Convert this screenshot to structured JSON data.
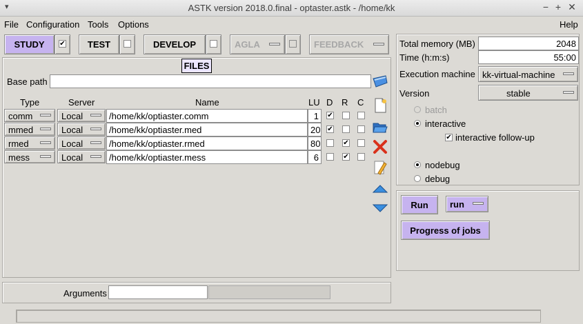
{
  "window": {
    "title": "ASTK version 2018.0.final - optaster.astk - /home/kk",
    "menu_arrow": "▾",
    "minimize": "−",
    "maximize": "+",
    "close": "✕"
  },
  "menubar": {
    "file": "File",
    "configuration": "Configuration",
    "tools": "Tools",
    "options": "Options",
    "help": "Help"
  },
  "modes": {
    "study": "STUDY",
    "test": "TEST",
    "develop": "DEVELOP",
    "agla": "AGLA",
    "feedback": "FEEDBACK"
  },
  "files_panel": {
    "title": "FILES",
    "base_path_label": "Base path",
    "base_path_value": "",
    "col_type": "Type",
    "col_server": "Server",
    "col_name": "Name",
    "col_lu": "LU",
    "col_d": "D",
    "col_r": "R",
    "col_c": "C",
    "rows": [
      {
        "type": "comm",
        "server": "Local",
        "name": "/home/kk/optiaster.comm",
        "lu": "1",
        "d": true,
        "r": false,
        "c": false
      },
      {
        "type": "mmed",
        "server": "Local",
        "name": "/home/kk/optiaster.med",
        "lu": "20",
        "d": true,
        "r": false,
        "c": false
      },
      {
        "type": "rmed",
        "server": "Local",
        "name": "/home/kk/optiaster.rmed",
        "lu": "80",
        "d": false,
        "r": true,
        "c": false
      },
      {
        "type": "mess",
        "server": "Local",
        "name": "/home/kk/optiaster.mess",
        "lu": "6",
        "d": false,
        "r": true,
        "c": false
      }
    ],
    "arguments_label": "Arguments",
    "arguments_value": ""
  },
  "params": {
    "total_memory_label": "Total memory (MB)",
    "total_memory_value": "2048",
    "time_label": "Time (h:m:s)",
    "time_value": "55:00",
    "exec_machine_label": "Execution machine",
    "exec_machine_value": "kk-virtual-machine",
    "version_label": "Version",
    "version_value": "stable",
    "batch": "batch",
    "interactive": "interactive",
    "interactive_followup": "interactive follow-up",
    "nodebug": "nodebug",
    "debug": "debug"
  },
  "run": {
    "run_button": "Run",
    "run_mode": "run",
    "progress_button": "Progress of jobs"
  },
  "colors": {
    "active_button": "#c6b3ef",
    "background": "#dcdad5"
  }
}
